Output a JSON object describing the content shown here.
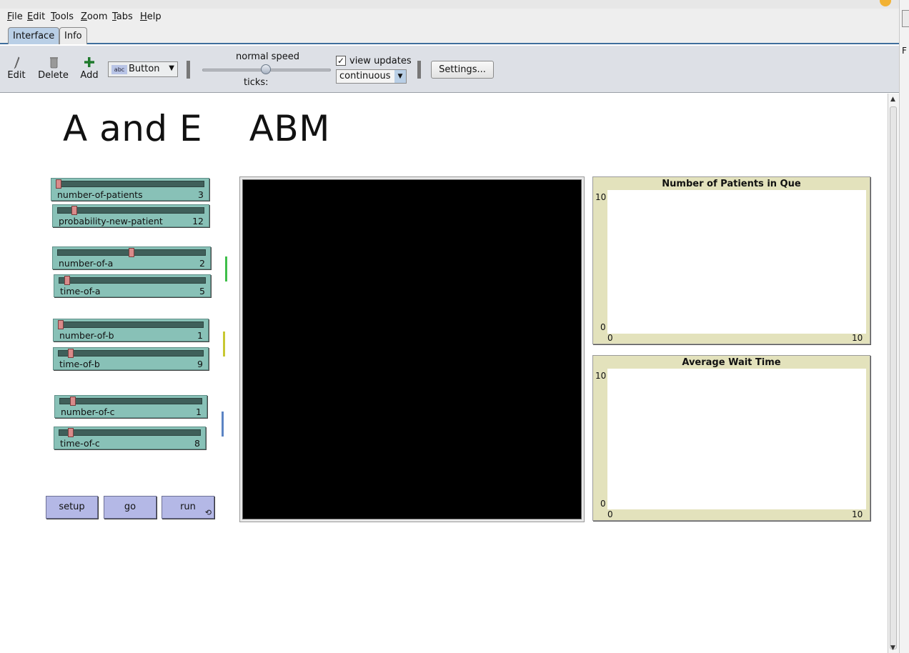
{
  "menubar": {
    "items": [
      {
        "mnemonic": "F",
        "rest": "ile"
      },
      {
        "mnemonic": "E",
        "rest": "dit"
      },
      {
        "mnemonic": "T",
        "rest": "ools"
      },
      {
        "mnemonic": "Z",
        "rest": "oom"
      },
      {
        "mnemonic": "T",
        "rest": "abs",
        "prefix": ""
      },
      {
        "mnemonic": "H",
        "rest": "elp"
      }
    ]
  },
  "tabs": {
    "interface": "Interface",
    "info": "Info"
  },
  "toolbar": {
    "edit": "Edit",
    "delete": "Delete",
    "add": "Add",
    "widget_type": "Button",
    "speed_label": "normal speed",
    "ticks_label": "ticks:",
    "view_updates_label": "view updates",
    "view_updates_checked": true,
    "update_mode": "continuous",
    "settings": "Settings..."
  },
  "model": {
    "title": "A and E    ABM",
    "sliders": [
      {
        "label": "number-of-patients",
        "value": "3",
        "knob": 0.0
      },
      {
        "label": "probability-new-patient",
        "value": "12",
        "knob": 0.1
      },
      {
        "label": "number-of-a",
        "value": "2",
        "knob": 0.5
      },
      {
        "label": "time-of-a",
        "value": "5",
        "knob": 0.04
      },
      {
        "label": "number-of-b",
        "value": "1",
        "knob": 0.0
      },
      {
        "label": "time-of-b",
        "value": "9",
        "knob": 0.07
      },
      {
        "label": "number-of-c",
        "value": "1",
        "knob": 0.08
      },
      {
        "label": "time-of-c",
        "value": "8",
        "knob": 0.07
      }
    ],
    "group_colors": {
      "a": "#3fbf4a",
      "b": "#c8c832",
      "c": "#5b84c4"
    },
    "buttons": {
      "setup": "setup",
      "go": "go",
      "run": "run"
    },
    "plots": [
      {
        "title": "Number of Patients in Que",
        "ymax": "10",
        "ymin": "0",
        "xmin": "0",
        "xmax": "10"
      },
      {
        "title": "Average Wait Time",
        "ymax": "10",
        "ymin": "0",
        "xmin": "0",
        "xmax": "10"
      }
    ]
  }
}
